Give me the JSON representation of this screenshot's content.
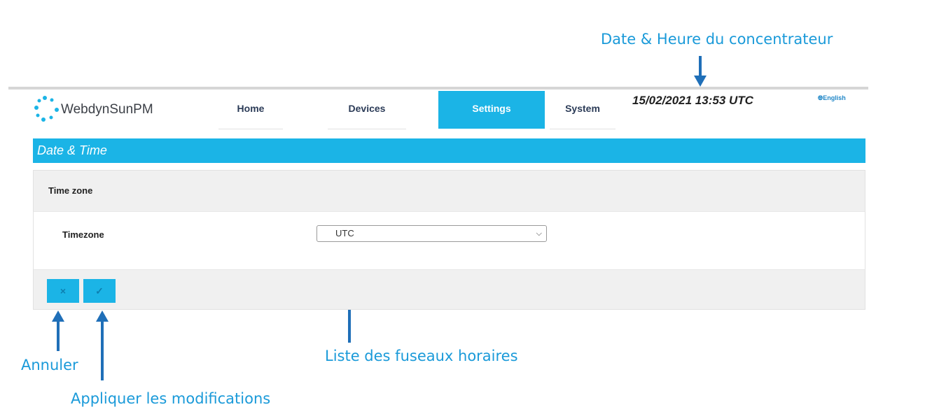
{
  "annotations": {
    "datetime": "Date & Heure du concentrateur",
    "timezone_list": "Liste des fuseaux horaires",
    "cancel": "Annuler",
    "apply": "Appliquer les modifications"
  },
  "header": {
    "brand": "WebdynSunPM",
    "tabs": [
      {
        "label": "Home",
        "active": false
      },
      {
        "label": "Devices",
        "active": false
      },
      {
        "label": "Settings",
        "active": true
      },
      {
        "label": "System",
        "active": false
      }
    ],
    "datetime": "15/02/2021 13:53 UTC",
    "language": "English"
  },
  "page": {
    "title": "Date & Time",
    "section_title": "Time zone",
    "timezone_label": "Timezone",
    "timezone_value": "UTC"
  },
  "buttons": {
    "cancel_icon": "×",
    "apply_icon": "✓"
  },
  "colors": {
    "accent": "#1bb4e6",
    "annotation": "#1a9ad9",
    "arrow": "#1f6fb8"
  }
}
